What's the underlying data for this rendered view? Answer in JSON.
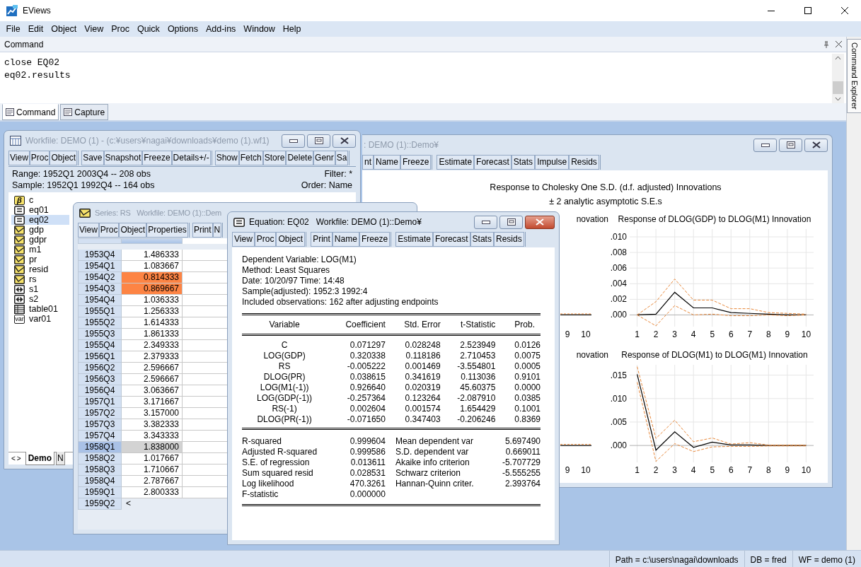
{
  "app": {
    "title": "EViews"
  },
  "menu": [
    "File",
    "Edit",
    "Object",
    "View",
    "Proc",
    "Quick",
    "Options",
    "Add-ins",
    "Window",
    "Help"
  ],
  "command_pane": {
    "title": "Command",
    "lines": [
      "close EQ02",
      "eq02.results"
    ],
    "tabs": [
      {
        "label": "Command",
        "selected": true
      },
      {
        "label": "Capture",
        "selected": false
      }
    ]
  },
  "side_tab": {
    "label": "Command Explorer"
  },
  "var_window": {
    "title": ": DEMO (1)::Demo¥",
    "active": false,
    "toolbar": [
      [
        "nt",
        "Name",
        "Freeze"
      ],
      [
        "Estimate",
        "Forecast",
        "Stats",
        "Impulse",
        "Resids"
      ]
    ],
    "heading": [
      "Response to Cholesky One S.D. (d.f. adjusted) Innovations",
      "± 2 analytic asymptotic S.E.s"
    ],
    "rows": [
      {
        "covered_title": "novation",
        "covered_xticks": [
          "9",
          "10"
        ],
        "chart": {
          "title": "Response of DLOG(GDP) to DLOG(M1) Innovation",
          "chart_data": {
            "type": "line",
            "x": [
              1,
              2,
              3,
              4,
              5,
              6,
              7,
              8,
              9,
              10
            ],
            "xlim": [
              0.6,
              10.4
            ],
            "ylim": [
              -0.0015,
              0.011
            ],
            "grid": true,
            "yticks": [
              {
                "value": 0,
                "label": ".000"
              },
              {
                "value": 0.002,
                "label": ".002"
              },
              {
                "value": 0.004,
                "label": ".004"
              },
              {
                "value": 0.006,
                "label": ".006"
              },
              {
                "value": 0.008,
                "label": ".008"
              },
              {
                "value": 0.01,
                "label": ".010"
              }
            ],
            "xticks": [
              1,
              2,
              3,
              4,
              5,
              6,
              7,
              8,
              9,
              10
            ],
            "series": [
              {
                "color": "#000000",
                "line_style": "solid",
                "values": [
                  0,
                  0.0001,
                  0.0029,
                  0.0009,
                  0.0009,
                  0.0003,
                  0.0002,
                  0.0001,
                  0,
                  0
                ]
              },
              {
                "color": "#e8883a",
                "line_style": "dashed",
                "values": [
                  0,
                  0.0017,
                  0.0046,
                  0.0019,
                  0.0019,
                  0.0008,
                  0.0008,
                  0.0003,
                  0.0002,
                  0.0001
                ]
              },
              {
                "color": "#e8883a",
                "line_style": "dashed",
                "values": [
                  0,
                  -0.0014,
                  0.0012,
                  0,
                  0.0001,
                  -0.0001,
                  -0.0001,
                  0,
                  -0.0001,
                  0
                ]
              }
            ]
          }
        }
      },
      {
        "covered_title": "novation",
        "covered_xticks": [
          "9",
          "10"
        ],
        "chart": {
          "title": "Response of DLOG(M1) to DLOG(M1) Innovation",
          "chart_data": {
            "type": "line",
            "x": [
              1,
              2,
              3,
              4,
              5,
              6,
              7,
              8,
              9,
              10
            ],
            "xlim": [
              0.6,
              10.4
            ],
            "ylim": [
              -0.0036,
              0.0172
            ],
            "grid": true,
            "yticks": [
              {
                "value": 0,
                "label": ".000"
              },
              {
                "value": 0.005,
                "label": ".005"
              },
              {
                "value": 0.01,
                "label": ".010"
              },
              {
                "value": 0.015,
                "label": ".015"
              }
            ],
            "xticks": [
              1,
              2,
              3,
              4,
              5,
              6,
              7,
              8,
              9,
              10
            ],
            "series": [
              {
                "color": "#000000",
                "line_style": "solid",
                "values": [
                  0.0152,
                  -0.001,
                  0.0029,
                  -0.0004,
                  0.0007,
                  0.0001,
                  0.0001,
                  0,
                  0,
                  0
                ]
              },
              {
                "color": "#e8883a",
                "line_style": "dashed",
                "values": [
                  0.0168,
                  0.0015,
                  0.0054,
                  0.0008,
                  0.0016,
                  0.0003,
                  0.0006,
                  0.0001,
                  0.0001,
                  0.0001
                ]
              },
              {
                "color": "#e8883a",
                "line_style": "dashed",
                "values": [
                  0.0135,
                  -0.0034,
                  0.0004,
                  -0.0013,
                  -0.0003,
                  -0.0002,
                  -0.0002,
                  -0.0001,
                  -0.0001,
                  -0.0001
                ]
              }
            ]
          }
        }
      }
    ]
  },
  "workfile_window": {
    "title": "Workfile: DEMO (1) - (c:¥users¥nagai¥downloads¥demo (1).wf1)",
    "active": false,
    "toolbar": [
      [
        "View",
        "Proc",
        "Object"
      ],
      [
        "Save",
        "Snapshot",
        "Freeze",
        "Details+/-"
      ],
      [
        "Show",
        "Fetch",
        "Store",
        "Delete",
        "Genr",
        "Sa"
      ]
    ],
    "range": "Range:  1952Q1 2003Q4  --  208 obs",
    "filter": "Filter: *",
    "sample": "Sample: 1952Q1 1992Q4  --  164 obs",
    "order": "Order: Name",
    "objects": [
      {
        "name": "c",
        "kind": "coef",
        "icon_text": "β",
        "selected": false
      },
      {
        "name": "eq01",
        "kind": "equation",
        "selected": false
      },
      {
        "name": "eq02",
        "kind": "equation",
        "selected": true
      },
      {
        "name": "gdp",
        "kind": "series",
        "selected": false
      },
      {
        "name": "gdpr",
        "kind": "series",
        "selected": false
      },
      {
        "name": "m1",
        "kind": "series",
        "selected": false
      },
      {
        "name": "pr",
        "kind": "series",
        "selected": false
      },
      {
        "name": "resid",
        "kind": "series",
        "selected": false
      },
      {
        "name": "rs",
        "kind": "series",
        "selected": false
      },
      {
        "name": "s1",
        "kind": "sample",
        "selected": false
      },
      {
        "name": "s2",
        "kind": "sample",
        "selected": false
      },
      {
        "name": "table01",
        "kind": "table",
        "selected": false
      },
      {
        "name": "var01",
        "kind": "var",
        "icon_text": "var",
        "selected": false
      }
    ],
    "page_nav": [
      "<",
      ">"
    ],
    "pages": [
      {
        "label": "Demo",
        "selected": true
      },
      {
        "label": "N",
        "selected": false
      }
    ]
  },
  "series_window": {
    "title": "Series: RS   Workfile: DEMO (1)::Dem",
    "active": false,
    "toolbar": [
      [
        "View",
        "Proc",
        "Object",
        "Properties"
      ],
      [
        "Print",
        "N"
      ]
    ],
    "rows": [
      {
        "date": "1953Q4",
        "value": "1.486333",
        "highlighted": false,
        "selected": false
      },
      {
        "date": "1954Q1",
        "value": "1.083667",
        "highlighted": false,
        "selected": false
      },
      {
        "date": "1954Q2",
        "value": "0.814333",
        "highlighted": true,
        "selected": false
      },
      {
        "date": "1954Q3",
        "value": "0.869667",
        "highlighted": true,
        "selected": false
      },
      {
        "date": "1954Q4",
        "value": "1.036333",
        "highlighted": false,
        "selected": false
      },
      {
        "date": "1955Q1",
        "value": "1.256333",
        "highlighted": false,
        "selected": false
      },
      {
        "date": "1955Q2",
        "value": "1.614333",
        "highlighted": false,
        "selected": false
      },
      {
        "date": "1955Q3",
        "value": "1.861333",
        "highlighted": false,
        "selected": false
      },
      {
        "date": "1955Q4",
        "value": "2.349333",
        "highlighted": false,
        "selected": false
      },
      {
        "date": "1956Q1",
        "value": "2.379333",
        "highlighted": false,
        "selected": false
      },
      {
        "date": "1956Q2",
        "value": "2.596667",
        "highlighted": false,
        "selected": false
      },
      {
        "date": "1956Q3",
        "value": "2.596667",
        "highlighted": false,
        "selected": false
      },
      {
        "date": "1956Q4",
        "value": "3.063667",
        "highlighted": false,
        "selected": false
      },
      {
        "date": "1957Q1",
        "value": "3.171667",
        "highlighted": false,
        "selected": false
      },
      {
        "date": "1957Q2",
        "value": "3.157000",
        "highlighted": false,
        "selected": false
      },
      {
        "date": "1957Q3",
        "value": "3.382333",
        "highlighted": false,
        "selected": false
      },
      {
        "date": "1957Q4",
        "value": "3.343333",
        "highlighted": false,
        "selected": false
      },
      {
        "date": "1958Q1",
        "value": "1.838000",
        "highlighted": false,
        "selected": true
      },
      {
        "date": "1958Q2",
        "value": "1.017667",
        "highlighted": false,
        "selected": false
      },
      {
        "date": "1958Q3",
        "value": "1.710667",
        "highlighted": false,
        "selected": false
      },
      {
        "date": "1958Q4",
        "value": "2.787667",
        "highlighted": false,
        "selected": false
      },
      {
        "date": "1959Q1",
        "value": "2.800333",
        "highlighted": false,
        "selected": false
      },
      {
        "date": "1959Q2",
        "selected": false
      }
    ],
    "hscroll_arrow": "<"
  },
  "equation_window": {
    "title": "Equation: EQ02   Workfile: DEMO (1)::Demo¥",
    "active": true,
    "toolbar": [
      [
        "View",
        "Proc",
        "Object"
      ],
      [
        "Print",
        "Name",
        "Freeze"
      ],
      [
        "Estimate",
        "Forecast",
        "Stats",
        "Resids"
      ]
    ],
    "header_lines": [
      "Dependent Variable: LOG(M1)",
      "Method: Least Squares",
      "Date: 10/20/97   Time: 14:48",
      "Sample(adjusted): 1952:3 1992:4",
      "Included observations: 162 after adjusting endpoints"
    ],
    "columns": [
      "Variable",
      "Coefficient",
      "Std. Error",
      "t-Statistic",
      "Prob."
    ],
    "rows": [
      [
        "C",
        "0.071297",
        "0.028248",
        "2.523949",
        "0.0126"
      ],
      [
        "LOG(GDP)",
        "0.320338",
        "0.118186",
        "2.710453",
        "0.0075"
      ],
      [
        "RS",
        "-0.005222",
        "0.001469",
        "-3.554801",
        "0.0005"
      ],
      [
        "DLOG(PR)",
        "0.038615",
        "0.341619",
        "0.113036",
        "0.9101"
      ],
      [
        "LOG(M1(-1))",
        "0.926640",
        "0.020319",
        "45.60375",
        "0.0000"
      ],
      [
        "LOG(GDP(-1))",
        "-0.257364",
        "0.123264",
        "-2.087910",
        "0.0385"
      ],
      [
        "RS(-1)",
        "0.002604",
        "0.001574",
        "1.654429",
        "0.1001"
      ],
      [
        "DLOG(PR(-1))",
        "-0.071650",
        "0.347403",
        "-0.206246",
        "0.8369"
      ]
    ],
    "stats": [
      [
        "R-squared",
        "0.999604",
        "Mean dependent var",
        "5.697490"
      ],
      [
        "Adjusted R-squared",
        "0.999586",
        "S.D. dependent var",
        "0.669011"
      ],
      [
        "S.E. of regression",
        "0.013611",
        "Akaike info criterion",
        "-5.707729"
      ],
      [
        "Sum squared resid",
        "0.028531",
        "Schwarz criterion",
        "-5.555255"
      ],
      [
        "Log likelihood",
        "470.3261",
        "Hannan-Quinn criter.",
        "2.393764"
      ],
      [
        "F-statistic",
        "0.000000"
      ]
    ]
  },
  "status_bar": [
    "Path = c:\\users\\nagai\\downloads",
    "DB = fred",
    "WF = demo (1)"
  ]
}
